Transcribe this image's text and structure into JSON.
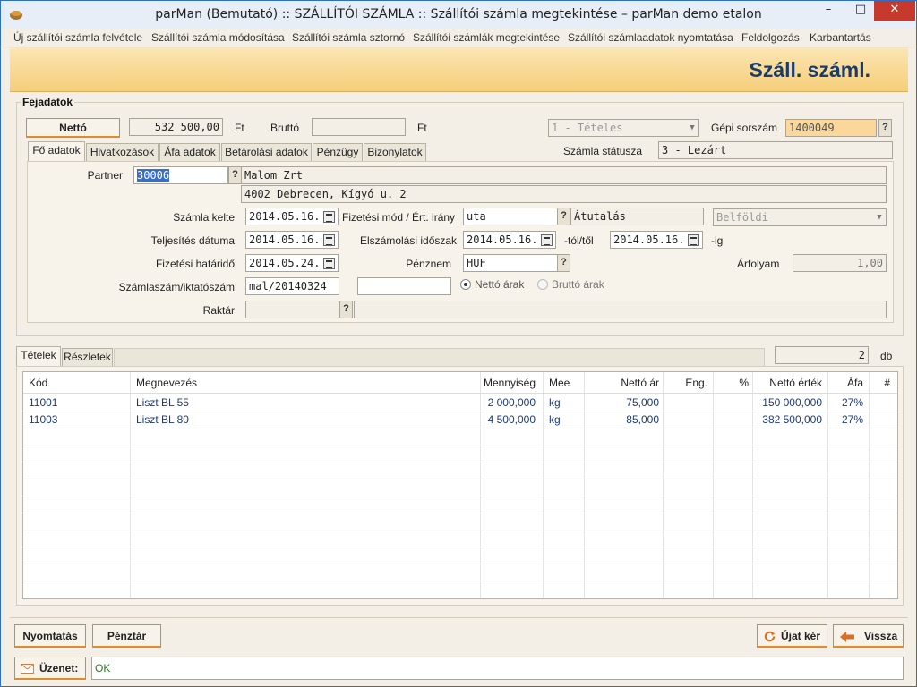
{
  "window": {
    "title": "parMan (Bemutató) :: SZÁLLÍTÓI SZÁMLA :: Szállítói számla megtekintése  –  parMan demo etalon",
    "min": "–",
    "max": "□",
    "close": "✕"
  },
  "menu": [
    "Új szállítói számla felvétele",
    "Szállítói számla módosítása",
    "Szállítói számla sztornó",
    "Szállítói számlák megtekintése",
    "Szállítói számlaadatok nyomtatása",
    "Feldolgozás",
    "Karbantartás"
  ],
  "banner": {
    "title": "Száll. száml."
  },
  "header": {
    "group_label": "Fejadatok",
    "netto_button": "Nettó",
    "netto_value": "532 500,00",
    "netto_currency": "Ft",
    "brutto_label": "Bruttó",
    "brutto_value": "",
    "brutto_currency": "Ft",
    "type_select": "1 - Tételes",
    "gepi_label": "Gépi sorszám",
    "gepi_value": "1400049",
    "status_label": "Számla státusza",
    "status_value": "3 - Lezárt"
  },
  "tabs": [
    "Fő adatok",
    "Hivatkozások",
    "Áfa adatok",
    "Betárolási adatok",
    "Pénzügy",
    "Bizonylatok"
  ],
  "main": {
    "partner_label": "Partner",
    "partner_code": "30006",
    "partner_name": "Malom Zrt",
    "partner_address": "4002 Debrecen, Kígyó u. 2",
    "kelte_label": "Számla kelte",
    "kelte_value": "2014.05.16.",
    "fizmod_label": "Fizetési mód / Ért. irány",
    "fizmod_value": "uta",
    "fizmod_name": "Átutalás",
    "belfoldi_value": "Belföldi",
    "teljesites_label": "Teljesítés dátuma",
    "teljesites_value": "2014.05.16.",
    "elszamolasi_label": "Elszámolási időszak",
    "elszamolasi_from": "2014.05.16.",
    "tol_label": "-tól/től",
    "elszamolasi_to": "2014.05.16.",
    "ig_label": "-ig",
    "hatarido_label": "Fizetési határidő",
    "hatarido_value": "2014.05.24.",
    "penznem_label": "Pénznem",
    "penznem_value": "HUF",
    "arfolyam_label": "Árfolyam",
    "arfolyam_value": "1,00",
    "szamlaszam_label": "Számlaszám/iktatószám",
    "szamlaszam_value": "mal/20140324",
    "iktato_value": "",
    "netto_arak": "Nettó árak",
    "brutto_arak": "Bruttó árak",
    "raktar_label": "Raktár",
    "raktar_value": "",
    "raktar_name": ""
  },
  "items": {
    "tabs": [
      "Tételek",
      "Részletek"
    ],
    "count": "2",
    "count_unit": "db",
    "columns": [
      "Kód",
      "Megnevezés",
      "Mennyiség",
      "Mee",
      "Nettó ár",
      "Eng.",
      "%",
      "Nettó érték",
      "Áfa",
      "#"
    ],
    "rows": [
      [
        "11001",
        "Liszt BL 55",
        "2 000,000",
        "kg",
        "75,000",
        "",
        "",
        "150 000,000",
        "27%",
        ""
      ],
      [
        "11003",
        "Liszt BL 80",
        "4 500,000",
        "kg",
        "85,000",
        "",
        "",
        "382 500,000",
        "27%",
        ""
      ]
    ]
  },
  "buttons": {
    "nyomtatas": "Nyomtatás",
    "penztar": "Pénztár",
    "ujat_ker": "Újat kér",
    "vissza": "Vissza"
  },
  "message": {
    "label": "Üzenet:",
    "text": "OK"
  }
}
